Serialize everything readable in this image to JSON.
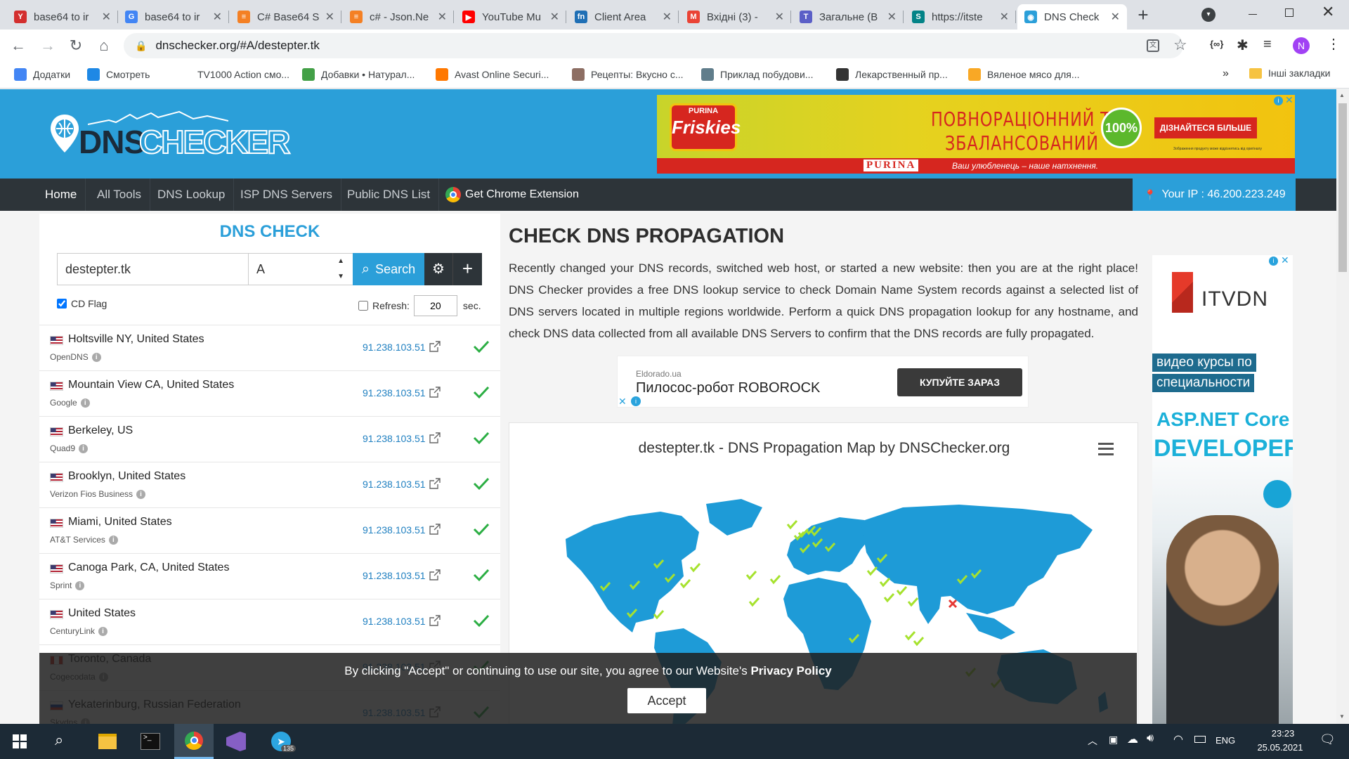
{
  "browser": {
    "tabs": [
      {
        "label": "base64 to ir",
        "icon": "yandex-icon",
        "color": "#d32f2f"
      },
      {
        "label": "base64 to ir",
        "icon": "google-icon",
        "color": "#4285f4"
      },
      {
        "label": "C# Base64 S",
        "icon": "stackoverflow-icon",
        "color": "#f48024"
      },
      {
        "label": "c# - Json.Ne",
        "icon": "stackoverflow-icon",
        "color": "#f48024"
      },
      {
        "label": "YouTube Mu",
        "icon": "youtube-icon",
        "color": "#ff0000"
      },
      {
        "label": "Client Area",
        "icon": "fn-icon",
        "color": "#1f6fb5"
      },
      {
        "label": "Вхідні (3) - ",
        "icon": "gmail-icon",
        "color": "#ea4335"
      },
      {
        "label": "Загальне (В",
        "icon": "teams-icon",
        "color": "#5b5fc7"
      },
      {
        "label": "https://itste",
        "icon": "sharepoint-icon",
        "color": "#038387"
      },
      {
        "label": "DNS Check",
        "icon": "dnschecker-icon",
        "color": "#2b9fd9"
      }
    ],
    "new_tab": "+",
    "url": "dnschecker.org/#A/destepter.tk",
    "profile_initial": "N",
    "bookmarks": [
      {
        "label": "Додатки",
        "icon": "apps-grid-icon",
        "color": "#4285f4"
      },
      {
        "label": "Смотреть",
        "icon": "s-logo-icon",
        "color": "#1e88e5"
      },
      {
        "label": "TV1000 Action смо...",
        "icon": "tv-icon",
        "color": "#ffffff"
      },
      {
        "label": "Добавки • Натурал...",
        "icon": "leaf-icon",
        "color": "#43a047"
      },
      {
        "label": "Avast Online Securi...",
        "icon": "avast-icon",
        "color": "#ff7800"
      },
      {
        "label": "Рецепты: Вкусно с...",
        "icon": "chef-icon",
        "color": "#8d6e63"
      },
      {
        "label": "Приклад побудови...",
        "icon": "drone-icon",
        "color": "#607d8b"
      },
      {
        "label": "Лекарственный пр...",
        "icon": "globe-dark-icon",
        "color": "#333333"
      },
      {
        "label": "Вяленое мясо для...",
        "icon": "meat-icon",
        "color": "#f9a825"
      }
    ],
    "more_bookmarks": "»",
    "other_bookmarks": "Інші закладки"
  },
  "site": {
    "logo_dns": "DNS",
    "logo_checker": "CHECKER",
    "ad_top": {
      "brand": "PURINA",
      "product": "Friskies",
      "headline_line1": "ПОВНОРАЦІОННИЙ ТА",
      "headline_line2": "ЗБАЛАНСОВАНИЙ",
      "badge": "100%",
      "cta": "ДІЗНАЙТЕСЯ БІЛЬШЕ",
      "disclaimer": "Зображення продукту може відрізнятись від оригіналу",
      "footer_brand": "PURINA",
      "footer_slogan": "Ваш улюбленець – наше натхнення."
    },
    "nav": {
      "items": [
        "Home",
        "All Tools",
        "DNS Lookup",
        "ISP DNS Servers",
        "Public DNS List"
      ],
      "extension": "Get Chrome Extension",
      "your_ip": "Your IP : 46.200.223.249"
    },
    "panel": {
      "title": "DNS CHECK",
      "domain_value": "destepter.tk",
      "record_type": "A",
      "search_label": "Search",
      "cd_flag_label": "CD Flag",
      "refresh_label": "Refresh:",
      "refresh_value": "20",
      "refresh_unit": "sec."
    },
    "results": [
      {
        "location": "Holtsville NY, United States",
        "provider": "OpenDNS",
        "ip": "91.238.103.51",
        "flag": "us"
      },
      {
        "location": "Mountain View CA, United States",
        "provider": "Google",
        "ip": "91.238.103.51",
        "flag": "us"
      },
      {
        "location": "Berkeley, US",
        "provider": "Quad9",
        "ip": "91.238.103.51",
        "flag": "us"
      },
      {
        "location": "Brooklyn, United States",
        "provider": "Verizon Fios Business",
        "ip": "91.238.103.51",
        "flag": "us"
      },
      {
        "location": "Miami, United States",
        "provider": "AT&T Services",
        "ip": "91.238.103.51",
        "flag": "us"
      },
      {
        "location": "Canoga Park, CA, United States",
        "provider": "Sprint",
        "ip": "91.238.103.51",
        "flag": "us"
      },
      {
        "location": "United States",
        "provider": "CenturyLink",
        "ip": "91.238.103.51",
        "flag": "us"
      },
      {
        "location": "Toronto, Canada",
        "provider": "Cogecodata",
        "ip": "91.238.103.51",
        "flag": "ca"
      },
      {
        "location": "Yekaterinburg, Russian Federation",
        "provider": "Skydns",
        "ip": "91.238.103.51",
        "flag": "ru"
      }
    ],
    "main": {
      "heading": "CHECK DNS PROPAGATION",
      "intro": "Recently changed your DNS records, switched web host, or started a new website: then you are at the right place! DNS Checker provides a free DNS lookup service to check Domain Name System records against a selected list of DNS servers located in multiple regions worldwide. Perform a quick DNS propagation lookup for any hostname, and check DNS data collected from all available DNS Servers to confirm that the DNS records are fully propagated."
    },
    "ad_mid": {
      "source": "Eldorado.ua",
      "product": "Пилосос-робот ROBOROCK",
      "cta": "КУПУЙТЕ ЗАРАЗ"
    },
    "map": {
      "title": "destepter.tk - DNS Propagation Map by DNSChecker.org"
    },
    "ad_side": {
      "brand": "ITVDN",
      "line1": "видео курсы по",
      "line2": "специальности",
      "line3": "ASP.NET Core",
      "line4": "DEVELOPER"
    },
    "cookie": {
      "text_before": "By clicking \"Accept\" or continuing to use our site, you agree to our Website's ",
      "link": "Privacy Policy",
      "accept": "Accept"
    }
  },
  "taskbar": {
    "telegram_badge": "135",
    "language": "ENG",
    "time": "23:23",
    "date": "25.05.2021"
  }
}
